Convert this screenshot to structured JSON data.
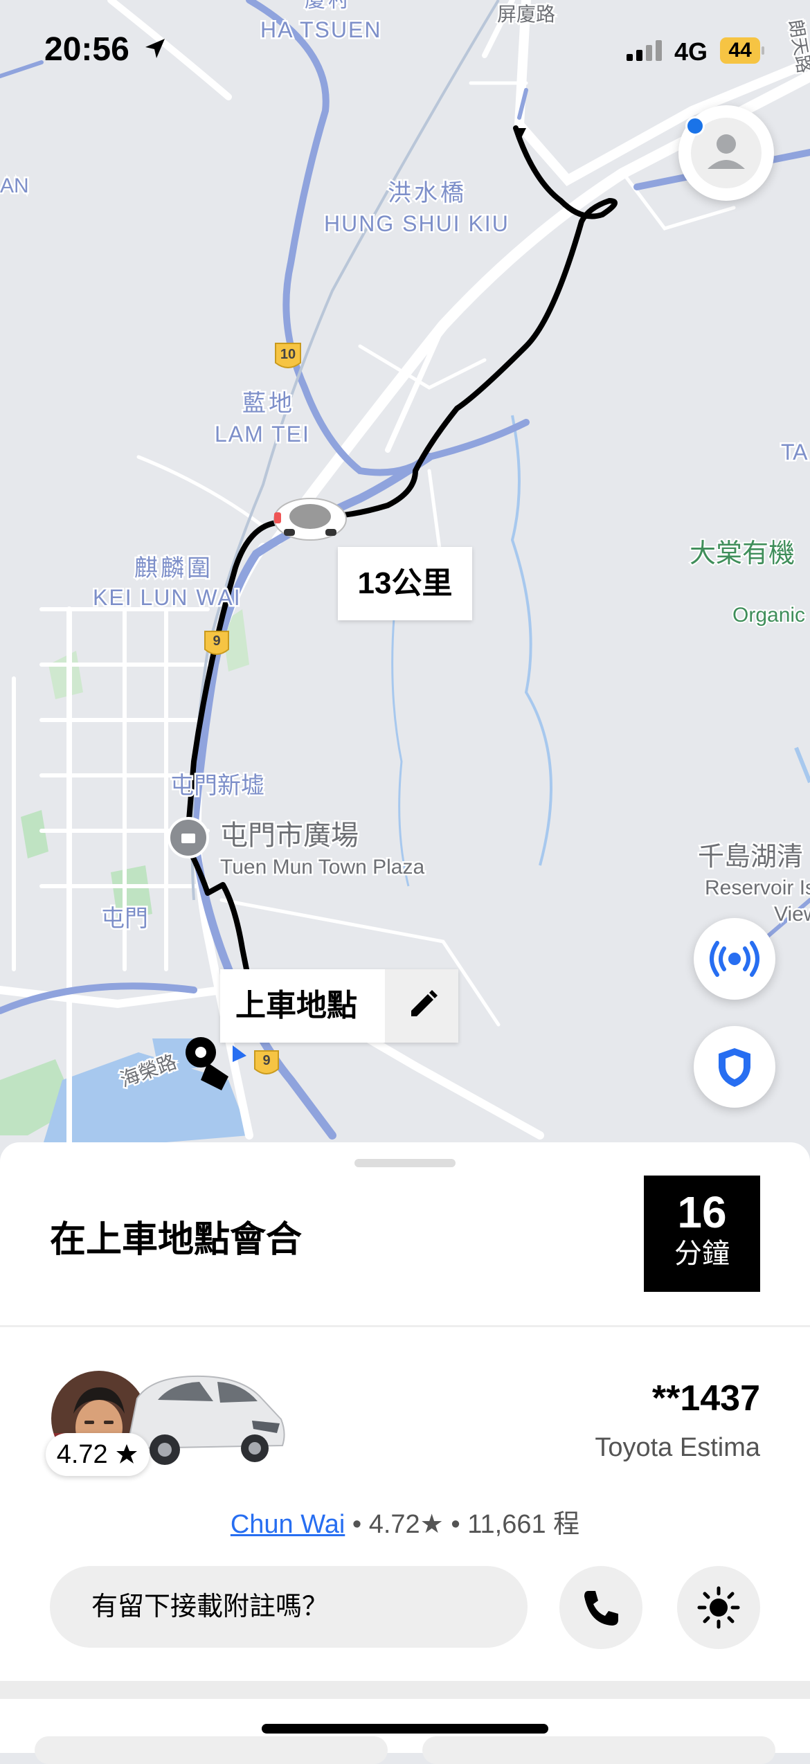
{
  "status_bar": {
    "time": "20:56",
    "network": "4G",
    "battery": "44"
  },
  "map": {
    "labels": {
      "ha_tsuen": "HA TSUEN",
      "ha_tsuen_zh": "廈村",
      "ping_ha_road": "屏廈路",
      "long_tin_road": "朗天路",
      "an_partial": "AN",
      "hung_shui_kiu_zh": "洪水橋",
      "hung_shui_kiu": "HUNG SHUI KIU",
      "lam_tei_zh": "藍地",
      "lam_tei": "LAM TEI",
      "ta_partial": "TA",
      "kei_lun_wai_zh": "麒麟圍",
      "kei_lun_wai": "KEI LUN WAI",
      "organic_zh": "大棠有機",
      "organic": "Organic",
      "tuen_mun_new_town": "屯門新墟",
      "town_plaza_zh": "屯門市廣場",
      "town_plaza": "Tuen Mun Town Plaza",
      "tuen_mun": "屯門",
      "reservoir_zh": "千島湖清",
      "reservoir": "Reservoir Is",
      "view_partial": "View",
      "hoi_wing_road": "海榮路",
      "route_10": "10",
      "route_9a": "9",
      "route_9b": "9"
    },
    "distance_label": "13公里",
    "pickup_label": "上車地點"
  },
  "sheet": {
    "meet_text": "在上車地點會合",
    "eta_value": "16",
    "eta_unit": "分鐘",
    "driver_rating_badge": "4.72",
    "plate": "**1437",
    "car_model": "Toyota Estima",
    "driver_name": "Chun Wai",
    "driver_rating": "4.72★",
    "driver_trips": "11,661 程",
    "note_placeholder": "有留下接載附註嗎？"
  },
  "icons": {
    "location_arrow": "location-arrow-icon",
    "profile": "person-icon",
    "edit": "pencil-icon",
    "broadcast": "broadcast-icon",
    "safety": "shield-icon",
    "phone": "phone-icon",
    "light": "sun-icon",
    "star": "star-icon"
  },
  "colors": {
    "route": "#000000",
    "accent_blue": "#276ef1",
    "battery": "#f6c443",
    "map_road_major": "#8fa3dd"
  }
}
